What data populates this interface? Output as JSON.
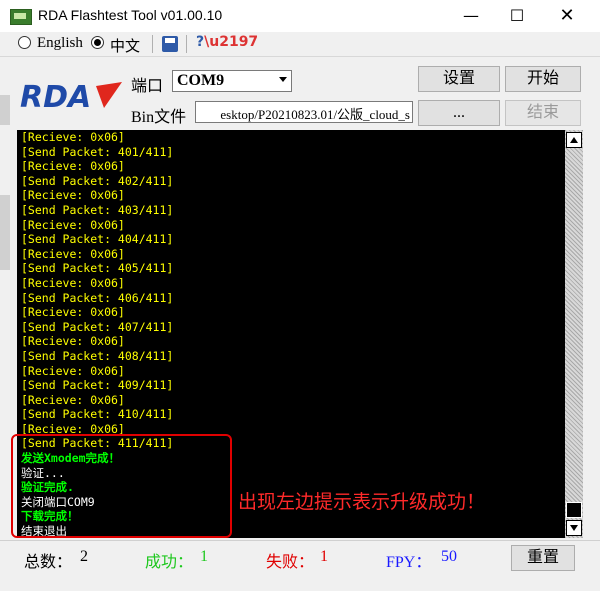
{
  "window": {
    "title": "RDA Flashtest Tool v01.00.10",
    "minimize_glyph": "—",
    "maximize_glyph": "☐",
    "close_glyph": "✕"
  },
  "toolbar": {
    "lang_english": "English",
    "lang_chinese": "中文",
    "selected_language": "中文"
  },
  "logo": {
    "text": "RDA",
    "color": "#1f4aa8",
    "accent": "#e0271d"
  },
  "port": {
    "label": "端口",
    "value": "COM9"
  },
  "bin": {
    "label": "Bin文件",
    "value": "esktop/P20210823.01/公版_cloud_s"
  },
  "buttons": {
    "settings": "设置",
    "start": "开始",
    "browse": "...",
    "stop": "结束"
  },
  "console": {
    "lines": [
      {
        "text": "[Recieve: 0x06]",
        "color": "yellow"
      },
      {
        "text": "[Send Packet: 401/411]",
        "color": "yellow"
      },
      {
        "text": "[Recieve: 0x06]",
        "color": "yellow"
      },
      {
        "text": "[Send Packet: 402/411]",
        "color": "yellow"
      },
      {
        "text": "[Recieve: 0x06]",
        "color": "yellow"
      },
      {
        "text": "[Send Packet: 403/411]",
        "color": "yellow"
      },
      {
        "text": "[Recieve: 0x06]",
        "color": "yellow"
      },
      {
        "text": "[Send Packet: 404/411]",
        "color": "yellow"
      },
      {
        "text": "[Recieve: 0x06]",
        "color": "yellow"
      },
      {
        "text": "[Send Packet: 405/411]",
        "color": "yellow"
      },
      {
        "text": "[Recieve: 0x06]",
        "color": "yellow"
      },
      {
        "text": "[Send Packet: 406/411]",
        "color": "yellow"
      },
      {
        "text": "[Recieve: 0x06]",
        "color": "yellow"
      },
      {
        "text": "[Send Packet: 407/411]",
        "color": "yellow"
      },
      {
        "text": "[Recieve: 0x06]",
        "color": "yellow"
      },
      {
        "text": "[Send Packet: 408/411]",
        "color": "yellow"
      },
      {
        "text": "[Recieve: 0x06]",
        "color": "yellow"
      },
      {
        "text": "[Send Packet: 409/411]",
        "color": "yellow"
      },
      {
        "text": "[Recieve: 0x06]",
        "color": "yellow"
      },
      {
        "text": "[Send Packet: 410/411]",
        "color": "yellow"
      },
      {
        "text": "[Recieve: 0x06]",
        "color": "yellow"
      },
      {
        "text": "[Send Packet: 411/411]",
        "color": "yellow"
      },
      {
        "text": "发送Xmodem完成！",
        "color": "green"
      },
      {
        "text": "验证...",
        "color": "white"
      },
      {
        "text": "验证完成.",
        "color": "green"
      },
      {
        "text": "关闭端口COM9",
        "color": "white"
      },
      {
        "text": "下载完成！",
        "color": "green"
      },
      {
        "text": "结束退出",
        "color": "white"
      }
    ]
  },
  "annotation": "出现左边提示表示升级成功！",
  "stats": {
    "total_label": "总数：",
    "total_value": "2",
    "success_label": "成功：",
    "success_value": "1",
    "fail_label": "失败：",
    "fail_value": "1",
    "fpy_label": "FPY：",
    "fpy_value": "50",
    "reset_button": "重置",
    "success_color": "#1ec81e",
    "fail_color": "#e00000",
    "fpy_color": "#1a1aff"
  }
}
